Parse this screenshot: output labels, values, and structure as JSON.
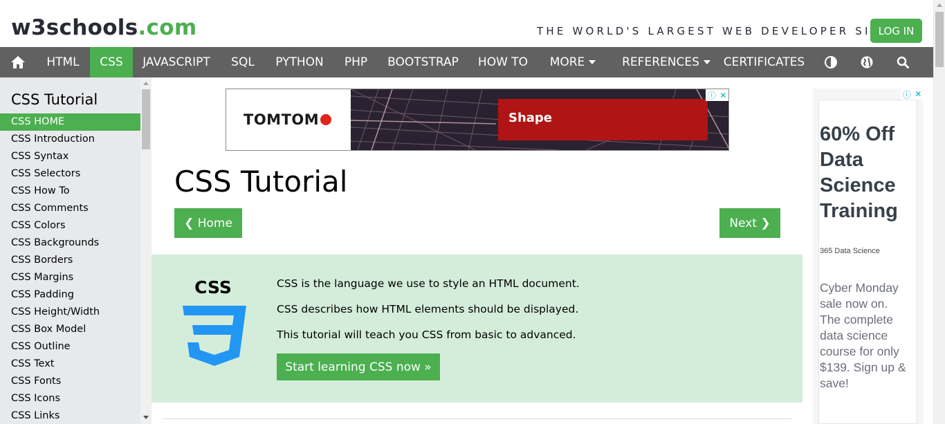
{
  "header": {
    "logo_w3": "w3schools",
    "logo_dotcom": ".com",
    "tagline": "THE WORLD'S LARGEST WEB DEVELOPER SITE",
    "login_label": "LOG IN"
  },
  "nav": {
    "items": [
      {
        "label": "HTML",
        "active": false
      },
      {
        "label": "CSS",
        "active": true
      },
      {
        "label": "JAVASCRIPT",
        "active": false
      },
      {
        "label": "SQL",
        "active": false
      },
      {
        "label": "PYTHON",
        "active": false
      },
      {
        "label": "PHP",
        "active": false
      },
      {
        "label": "BOOTSTRAP",
        "active": false
      },
      {
        "label": "HOW TO",
        "active": false
      },
      {
        "label": "MORE",
        "active": false
      },
      {
        "label": "REFERENCES",
        "active": false
      },
      {
        "label": "CERTIFICATES",
        "active": false
      }
    ],
    "icons": [
      "home-icon",
      "contrast-icon",
      "globe-icon",
      "search-icon"
    ]
  },
  "sidebar": {
    "title": "CSS Tutorial",
    "items": [
      "CSS HOME",
      "CSS Introduction",
      "CSS Syntax",
      "CSS Selectors",
      "CSS How To",
      "CSS Comments",
      "CSS Colors",
      "CSS Backgrounds",
      "CSS Borders",
      "CSS Margins",
      "CSS Padding",
      "CSS Height/Width",
      "CSS Box Model",
      "CSS Outline",
      "CSS Text",
      "CSS Fonts",
      "CSS Icons",
      "CSS Links"
    ],
    "active_item": "CSS HOME"
  },
  "ad_banner": {
    "brand": "TOMTOM",
    "cta": "Shape"
  },
  "main": {
    "title": "CSS Tutorial",
    "home_button": "❮ Home",
    "next_button": "Next ❯",
    "intro": {
      "logo_text": "CSS",
      "lines": [
        "CSS is the language we use to style an HTML document.",
        "CSS describes how HTML elements should be displayed.",
        "This tutorial will teach you CSS from basic to advanced."
      ],
      "start_button": "Start learning CSS now »"
    }
  },
  "right_ad": {
    "headline": "60% Off Data Science Training",
    "sponsor": "365 Data Science",
    "body": "Cyber Monday sale now on. The complete data science course for only $139. Sign up & save!"
  },
  "colors": {
    "green": "#4CAF50",
    "nav_bg": "#616161",
    "sidebar_bg": "#E7E9EB",
    "intro_bg": "#D4EDDA",
    "css_blue": "#2196F3"
  }
}
